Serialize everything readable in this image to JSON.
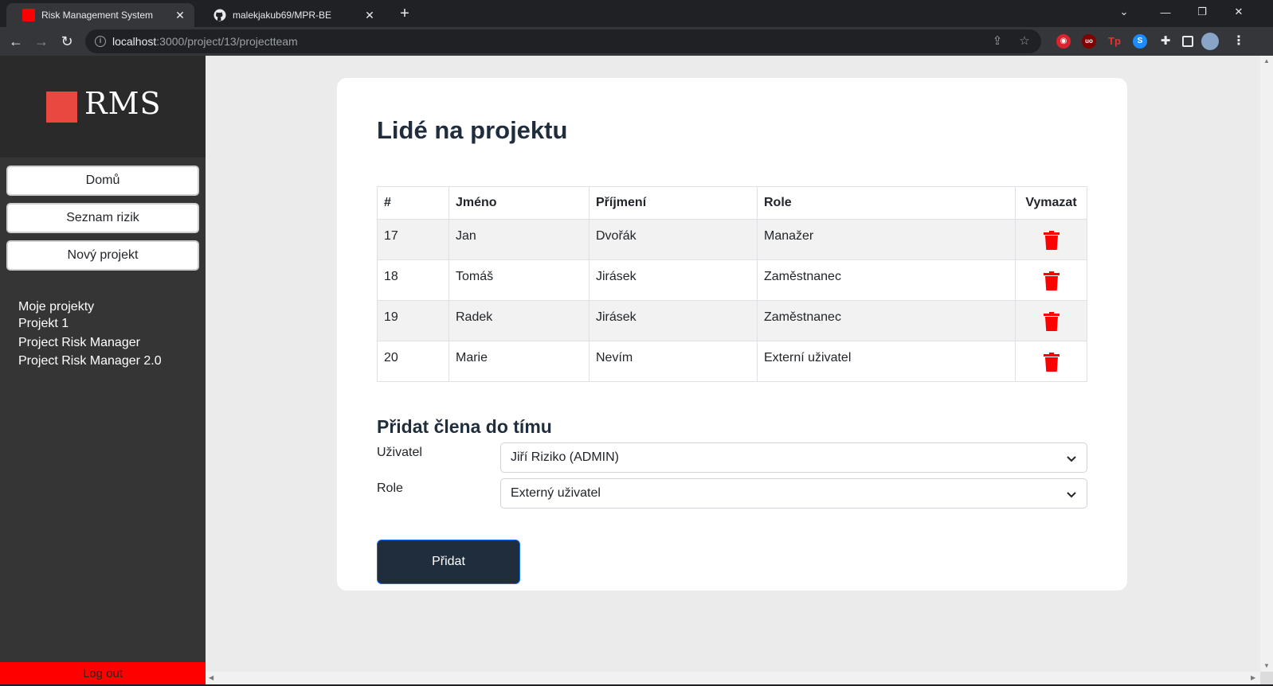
{
  "browser": {
    "tabs": [
      {
        "title": "Risk Management System",
        "active": true
      },
      {
        "title": "malekjakub69/MPR-BE",
        "active": false
      }
    ],
    "url_host": "localhost",
    "url_path": ":3000/project/13/projectteam"
  },
  "sidebar": {
    "logo_text": "RMS",
    "logo_color": "#e8483f",
    "buttons": [
      "Domů",
      "Seznam rizik",
      "Nový projekt"
    ],
    "projects_heading": "Moje projekty",
    "projects": [
      "Projekt 1",
      "Project Risk Manager",
      "Project Risk Manager 2.0"
    ],
    "logout_label": "Log out",
    "logout_color": "#ff0000"
  },
  "main": {
    "title": "Lidé na projektu",
    "table": {
      "headers": [
        "#",
        "Jméno",
        "Příjmení",
        "Role",
        "Vymazat"
      ],
      "rows": [
        {
          "id": "17",
          "first": "Jan",
          "last": "Dvořák",
          "role": "Manažer"
        },
        {
          "id": "18",
          "first": "Tomáš",
          "last": "Jirásek",
          "role": "Zaměstnanec"
        },
        {
          "id": "19",
          "first": "Radek",
          "last": "Jirásek",
          "role": "Zaměstnanec"
        },
        {
          "id": "20",
          "first": "Marie",
          "last": "Nevím",
          "role": "Externí uživatel"
        }
      ],
      "delete_icon": "trash-icon",
      "delete_color": "#ff0000"
    },
    "add_section": {
      "title": "Přidat člena do tímu",
      "user_label": "Uživatel",
      "user_value": "Jiří Riziko (ADMIN)",
      "role_label": "Role",
      "role_value": "Externý uživatel",
      "submit_label": "Přidat"
    }
  }
}
